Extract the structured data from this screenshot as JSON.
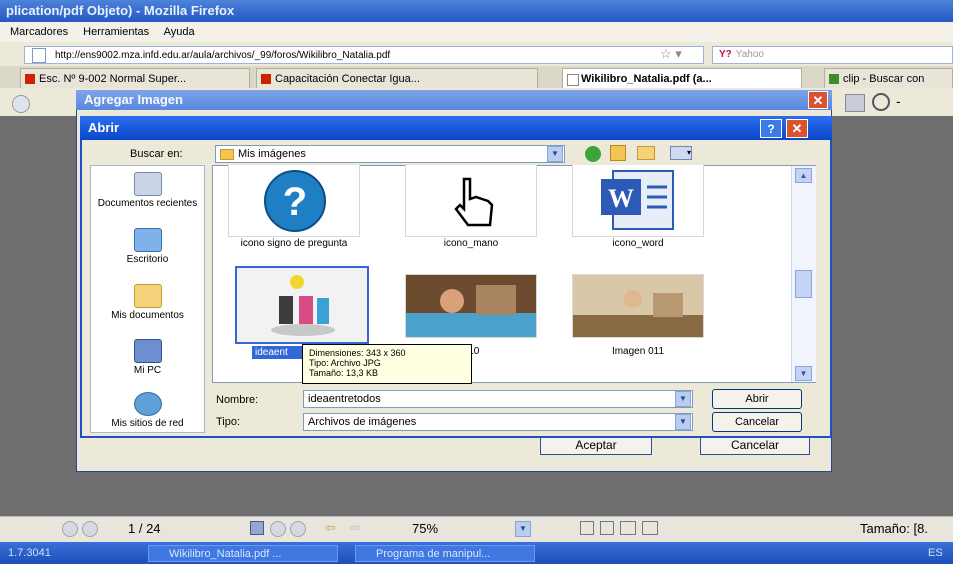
{
  "browser": {
    "title": "plication/pdf Objeto) - Mozilla Firefox",
    "menu": [
      "Marcadores",
      "Herramientas",
      "Ayuda"
    ],
    "url": "http://ens9002.mza.infd.edu.ar/aula/archivos/_99/foros/Wikilibro_Natalia.pdf",
    "search_placeholder": "Yahoo",
    "search_logo": "Y?",
    "tabs": [
      {
        "label": "Esc. Nº 9-002 Normal Super..."
      },
      {
        "label": "Capacitación Conectar Igua..."
      },
      {
        "label": "Wikilibro_Natalia.pdf (a..."
      },
      {
        "label": "clip - Buscar con"
      }
    ]
  },
  "agregar_dialog": {
    "title": "Agregar Imagen",
    "ok_label": "Aceptar",
    "cancel_label": "Cancelar"
  },
  "abrir_dialog": {
    "title": "Abrir",
    "look_in_label": "Buscar en:",
    "look_in_value": "Mis imágenes",
    "places": [
      {
        "label": "Documentos recientes",
        "icon": "recent-documents-icon"
      },
      {
        "label": "Escritorio",
        "icon": "desktop-icon"
      },
      {
        "label": "Mis documentos",
        "icon": "my-documents-icon"
      },
      {
        "label": "Mi PC",
        "icon": "my-computer-icon"
      },
      {
        "label": "Mis sitios de red",
        "icon": "network-places-icon"
      }
    ],
    "files": [
      {
        "name": "icono signo de pregunta"
      },
      {
        "name": "icono_mano"
      },
      {
        "name": "icono_word"
      },
      {
        "name": "ideaent"
      },
      {
        "name": "010"
      },
      {
        "name": "Imagen 011"
      }
    ],
    "tooltip": {
      "line1": "Dimensiones: 343 x 360",
      "line2": "Tipo: Archivo JPG",
      "line3": "Tamaño: 13,3 KB"
    },
    "filename_label": "Nombre:",
    "filename_value": "ideaentretodos",
    "filetype_label": "Tipo:",
    "filetype_value": "Archivos de imágenes",
    "open_label": "Abrir",
    "cancel_label": "Cancelar"
  },
  "pdf_toolbar": {
    "page": "1 / 24",
    "zoom": "75%",
    "size_label": "Tamaño: [8."
  },
  "taskbar": {
    "left_text": "1.7.3041",
    "items": [
      "Wikilibro_Natalia.pdf ...",
      "Programa de manipul..."
    ],
    "lang": "ES"
  }
}
